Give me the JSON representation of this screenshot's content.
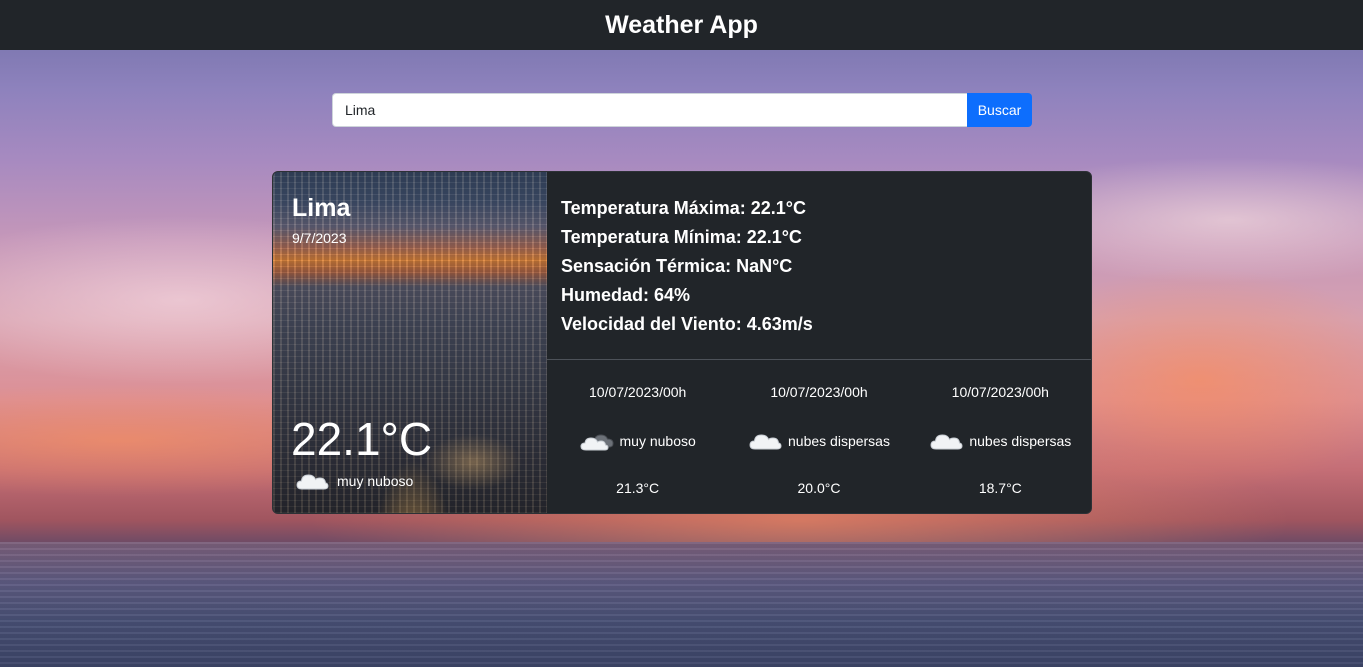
{
  "header": {
    "title": "Weather App"
  },
  "search": {
    "value": "Lima",
    "placeholder": "",
    "button_label": "Buscar"
  },
  "city": {
    "name": "Lima",
    "date": "9/7/2023",
    "temperature": "22.1°C",
    "condition": "muy nuboso",
    "condition_icon": "cloud-icon"
  },
  "details": {
    "max_temp": "Temperatura Máxima: 22.1°C",
    "min_temp": "Temperatura Mínima: 22.1°C",
    "feels_like": "Sensación Térmica: NaN°C",
    "humidity": "Humedad: 64%",
    "wind": "Velocidad del Viento: 4.63m/s"
  },
  "forecast": [
    {
      "date": "10/07/2023/00h",
      "condition": "muy nuboso",
      "icon": "dark-cloud-icon",
      "temp": "21.3°C"
    },
    {
      "date": "10/07/2023/00h",
      "condition": "nubes dispersas",
      "icon": "cloud-icon",
      "temp": "20.0°C"
    },
    {
      "date": "10/07/2023/00h",
      "condition": "nubes dispersas",
      "icon": "cloud-icon",
      "temp": "18.7°C"
    }
  ],
  "colors": {
    "header_bg": "#212529",
    "card_bg": "#212529",
    "button": "#0d6efd"
  }
}
